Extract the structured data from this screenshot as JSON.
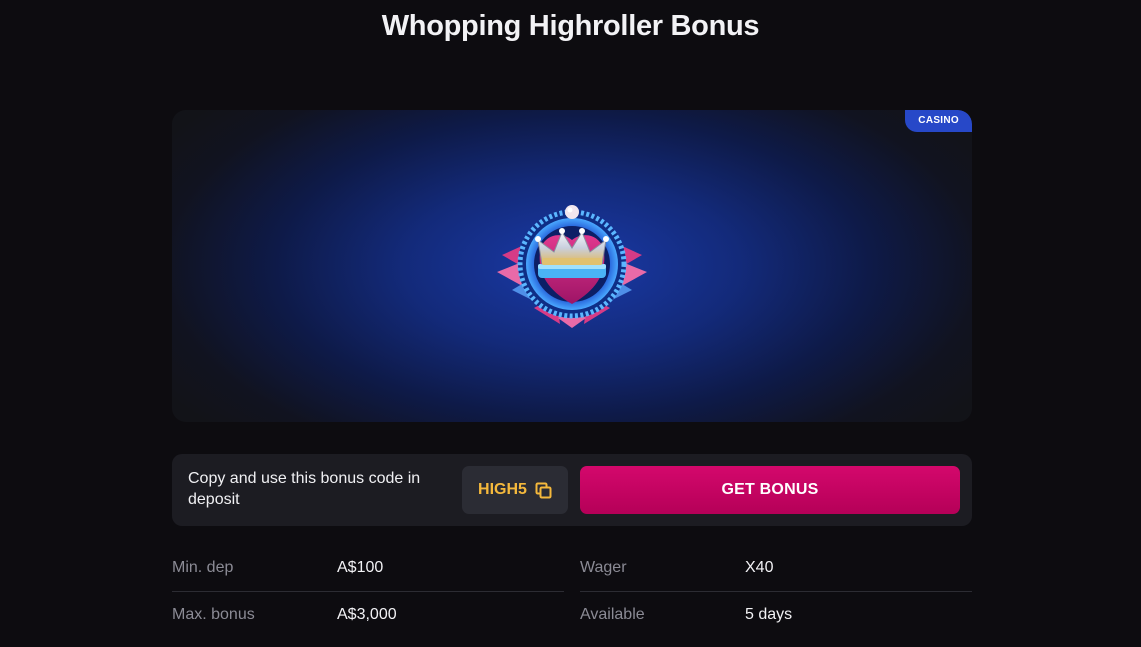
{
  "page": {
    "title": "Whopping Highroller Bonus"
  },
  "hero": {
    "badge": "CASINO",
    "image_icon": "crown-emblem-icon"
  },
  "code_panel": {
    "instruction": "Copy and use this bonus code in deposit",
    "code": "HIGH5",
    "copy_icon": "copy-icon",
    "cta_label": "GET BONUS"
  },
  "details": {
    "left": [
      {
        "label": "Min. dep",
        "value": "A$100"
      },
      {
        "label": "Max. bonus",
        "value": "A$3,000"
      }
    ],
    "right": [
      {
        "label": "Wager",
        "value": "X40"
      },
      {
        "label": "Available",
        "value": "5 days"
      }
    ]
  },
  "colors": {
    "background": "#0d0c10",
    "badge": "#2748c8",
    "code_text": "#f5b93c",
    "cta": "#c8046a",
    "panel": "#1c1c22"
  }
}
